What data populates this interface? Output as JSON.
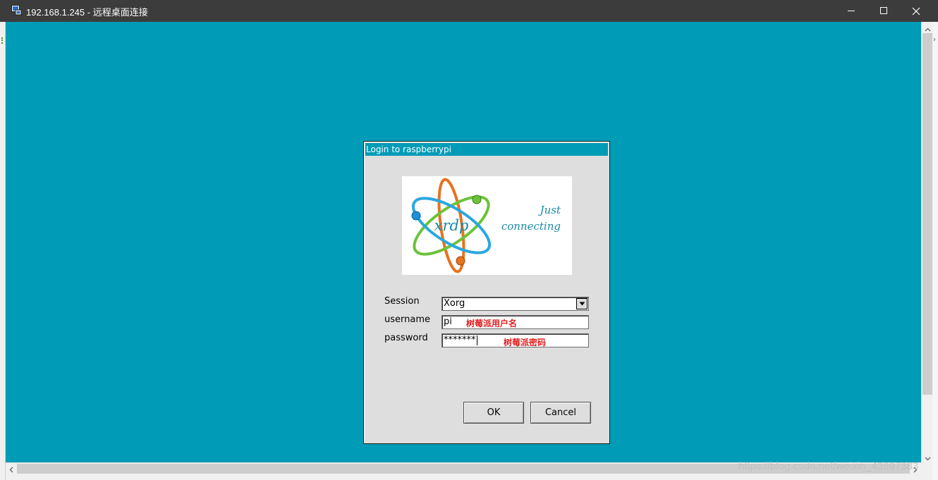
{
  "window": {
    "title": "192.168.1.245 - 远程桌面连接",
    "icons": {
      "app": "remote-desktop-icon",
      "minimize": "minimize-icon",
      "maximize": "maximize-icon",
      "close": "close-icon"
    }
  },
  "colors": {
    "titlebar": "#3c3c3c",
    "desktop": "#009cb7",
    "dialog": "#dedede",
    "annotation": "#e02020"
  },
  "dialog": {
    "title": "Login to raspberrypi",
    "logo": {
      "brand": "xrdp",
      "tagline_1": "Just",
      "tagline_2": "connecting"
    },
    "session": {
      "label": "Session",
      "value": "Xorg"
    },
    "username": {
      "label": "username",
      "value": "pi",
      "annotation": "树莓派用户名"
    },
    "password": {
      "label": "password",
      "value": "*******",
      "annotation": "树莓派密码"
    },
    "ok_label": "OK",
    "cancel_label": "Cancel"
  },
  "watermark": "https://blog.csdn.net/weixin_43697383"
}
